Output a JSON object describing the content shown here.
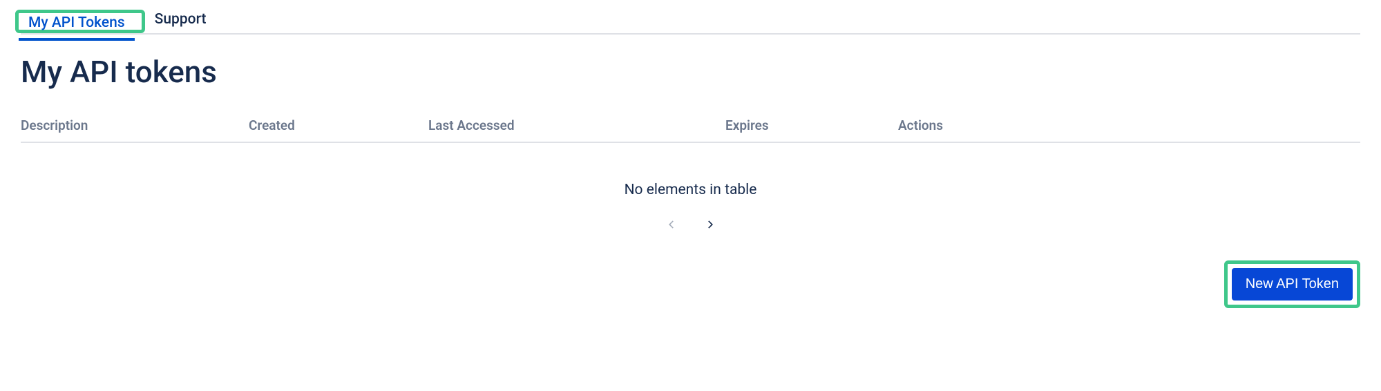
{
  "tabs": {
    "my_api_tokens": "My API Tokens",
    "support": "Support"
  },
  "page_title": "My API tokens",
  "table": {
    "columns": {
      "description": "Description",
      "created": "Created",
      "last_accessed": "Last Accessed",
      "expires": "Expires",
      "actions": "Actions"
    },
    "empty_message": "No elements in table",
    "rows": []
  },
  "buttons": {
    "new_api_token": "New API Token"
  }
}
